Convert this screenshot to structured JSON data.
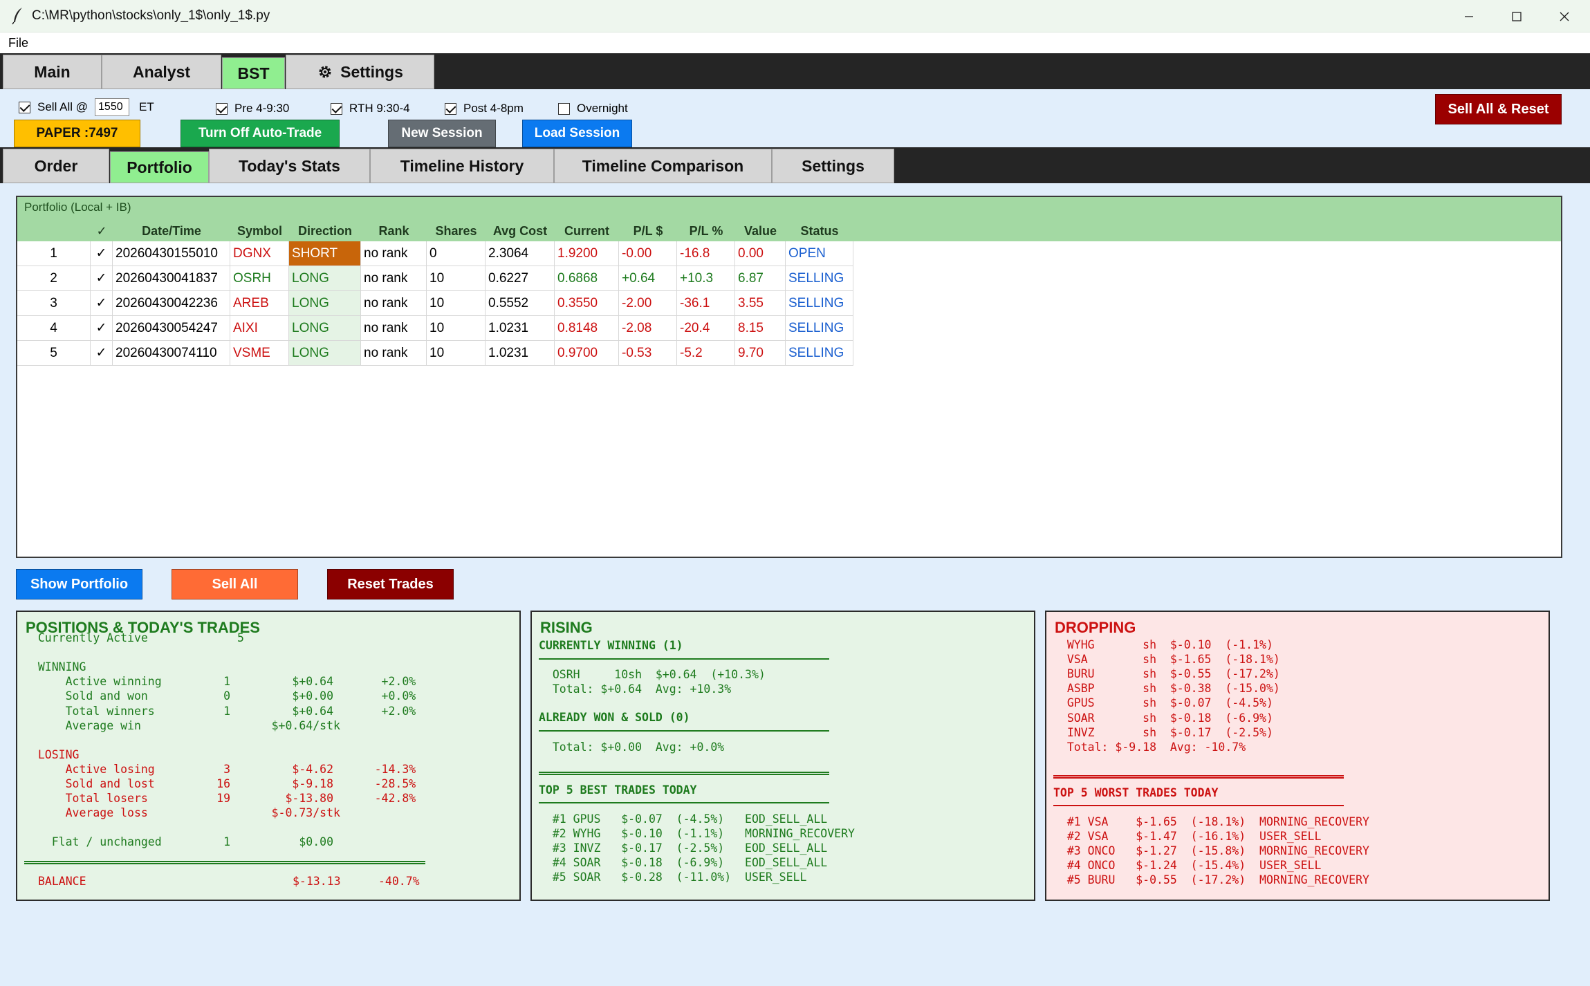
{
  "window": {
    "title": "C:\\MR\\python\\stocks\\only_1$\\only_1$.py"
  },
  "menu": {
    "file": "File"
  },
  "main_tabs": [
    {
      "label": "Main"
    },
    {
      "label": "Analyst"
    },
    {
      "label": "BST"
    },
    {
      "label": "Settings"
    }
  ],
  "controls": {
    "sell_all_at": "Sell All @",
    "sell_all_time": "1550",
    "et": "ET",
    "pre": "Pre 4-9:30",
    "rth": "RTH 9:30-4",
    "post": "Post 4-8pm",
    "overnight": "Overnight",
    "paper": "PAPER :7497",
    "turn_off_auto": "Turn Off Auto-Trade",
    "new_session": "New Session",
    "load_session": "Load Session",
    "sell_all_reset": "Sell All & Reset"
  },
  "sub_tabs": [
    {
      "label": "Order"
    },
    {
      "label": "Portfolio"
    },
    {
      "label": "Today's Stats"
    },
    {
      "label": "Timeline History"
    },
    {
      "label": "Timeline Comparison"
    },
    {
      "label": "Settings"
    }
  ],
  "portfolio": {
    "title": "Portfolio (Local + IB)",
    "columns": [
      "",
      "✓",
      "Date/Time",
      "Symbol",
      "Direction",
      "Rank",
      "Shares",
      "Avg Cost",
      "Current",
      "P/L $",
      "P/L %",
      "Value",
      "Status"
    ],
    "rows": [
      {
        "num": "1",
        "check": "✓",
        "datetime": "20260430155010",
        "symbol": "DGNX",
        "direction": "SHORT",
        "rank": "no rank",
        "shares": "0",
        "avg_cost": "2.3064",
        "current": "1.9200",
        "pl_dollar": "-0.00",
        "pl_pct": "-16.8",
        "value": "0.00",
        "status": "OPEN"
      },
      {
        "num": "2",
        "check": "✓",
        "datetime": "20260430041837",
        "symbol": "OSRH",
        "direction": "LONG",
        "rank": "no rank",
        "shares": "10",
        "avg_cost": "0.6227",
        "current": "0.6868",
        "pl_dollar": "+0.64",
        "pl_pct": "+10.3",
        "value": "6.87",
        "status": "SELLING"
      },
      {
        "num": "3",
        "check": "✓",
        "datetime": "20260430042236",
        "symbol": "AREB",
        "direction": "LONG",
        "rank": "no rank",
        "shares": "10",
        "avg_cost": "0.5552",
        "current": "0.3550",
        "pl_dollar": "-2.00",
        "pl_pct": "-36.1",
        "value": "3.55",
        "status": "SELLING"
      },
      {
        "num": "4",
        "check": "✓",
        "datetime": "20260430054247",
        "symbol": "AIXI",
        "direction": "LONG",
        "rank": "no rank",
        "shares": "10",
        "avg_cost": "1.0231",
        "current": "0.8148",
        "pl_dollar": "-2.08",
        "pl_pct": "-20.4",
        "value": "8.15",
        "status": "SELLING"
      },
      {
        "num": "5",
        "check": "✓",
        "datetime": "20260430074110",
        "symbol": "VSME",
        "direction": "LONG",
        "rank": "no rank",
        "shares": "10",
        "avg_cost": "1.0231",
        "current": "0.9700",
        "pl_dollar": "-0.53",
        "pl_pct": "-5.2",
        "value": "9.70",
        "status": "SELLING"
      }
    ]
  },
  "buttons": {
    "show_portfolio": "Show Portfolio",
    "sell_all": "Sell All",
    "reset_trades": "Reset Trades"
  },
  "positions_panel": {
    "title": "POSITIONS & TODAY'S TRADES",
    "lines": [
      "  Currently Active             5",
      "",
      "  WINNING",
      "      Active winning         1         $+0.64       +2.0%",
      "      Sold and won           0         $+0.00       +0.0%",
      "      Total winners          1         $+0.64       +2.0%",
      "      Average win                   $+0.64/stk",
      "",
      "  LOSING",
      "      Active losing          3         $-4.62      -14.3%",
      "      Sold and lost         16         $-9.18      -28.5%",
      "      Total losers          19        $-13.80      -42.8%",
      "      Average loss                  $-0.73/stk",
      "",
      "    Flat / unchanged         1          $0.00"
    ],
    "balance_label": "BALANCE",
    "balance_value": "$-13.13",
    "balance_pct": "-40.7%"
  },
  "rising_panel": {
    "title": "RISING",
    "winning_header": "CURRENTLY WINNING (1)",
    "winning_lines": [
      "  OSRH     10sh  $+0.64  (+10.3%)",
      "  Total: $+0.64  Avg: +10.3%"
    ],
    "sold_header": "ALREADY WON & SOLD (0)",
    "sold_lines": [
      "  Total: $+0.00  Avg: +0.0%"
    ],
    "top_header": "TOP 5 BEST TRADES TODAY",
    "top_lines": [
      "  #1 GPUS   $-0.07  (-4.5%)   EOD_SELL_ALL",
      "  #2 WYHG   $-0.10  (-1.1%)   MORNING_RECOVERY",
      "  #3 INVZ   $-0.17  (-2.5%)   EOD_SELL_ALL",
      "  #4 SOAR   $-0.18  (-6.9%)   EOD_SELL_ALL",
      "  #5 SOAR   $-0.28  (-11.0%)  USER_SELL"
    ]
  },
  "dropping_panel": {
    "title": "DROPPING",
    "lines": [
      "  WYHG       sh  $-0.10  (-1.1%)",
      "  VSA        sh  $-1.65  (-18.1%)",
      "  BURU       sh  $-0.55  (-17.2%)",
      "  ASBP       sh  $-0.38  (-15.0%)",
      "  GPUS       sh  $-0.07  (-4.5%)",
      "  SOAR       sh  $-0.18  (-6.9%)",
      "  INVZ       sh  $-0.17  (-2.5%)",
      "  Total: $-9.18  Avg: -10.7%"
    ],
    "top_header": "TOP 5 WORST TRADES TODAY",
    "top_lines": [
      "  #1 VSA    $-1.65  (-18.1%)  MORNING_RECOVERY",
      "  #2 VSA    $-1.47  (-16.1%)  USER_SELL",
      "  #3 ONCO   $-1.27  (-15.8%)  MORNING_RECOVERY",
      "  #4 ONCO   $-1.24  (-15.4%)  USER_SELL",
      "  #5 BURU   $-0.55  (-17.2%)  MORNING_RECOVERY"
    ]
  },
  "colors": {
    "green_text": "#1e7b1e",
    "red_text": "#cc1111",
    "blue_text": "#1a5fd0",
    "short_bg": "#c8650a",
    "long_bg": "#e5f3e5",
    "tab_active": "#90ee90"
  }
}
